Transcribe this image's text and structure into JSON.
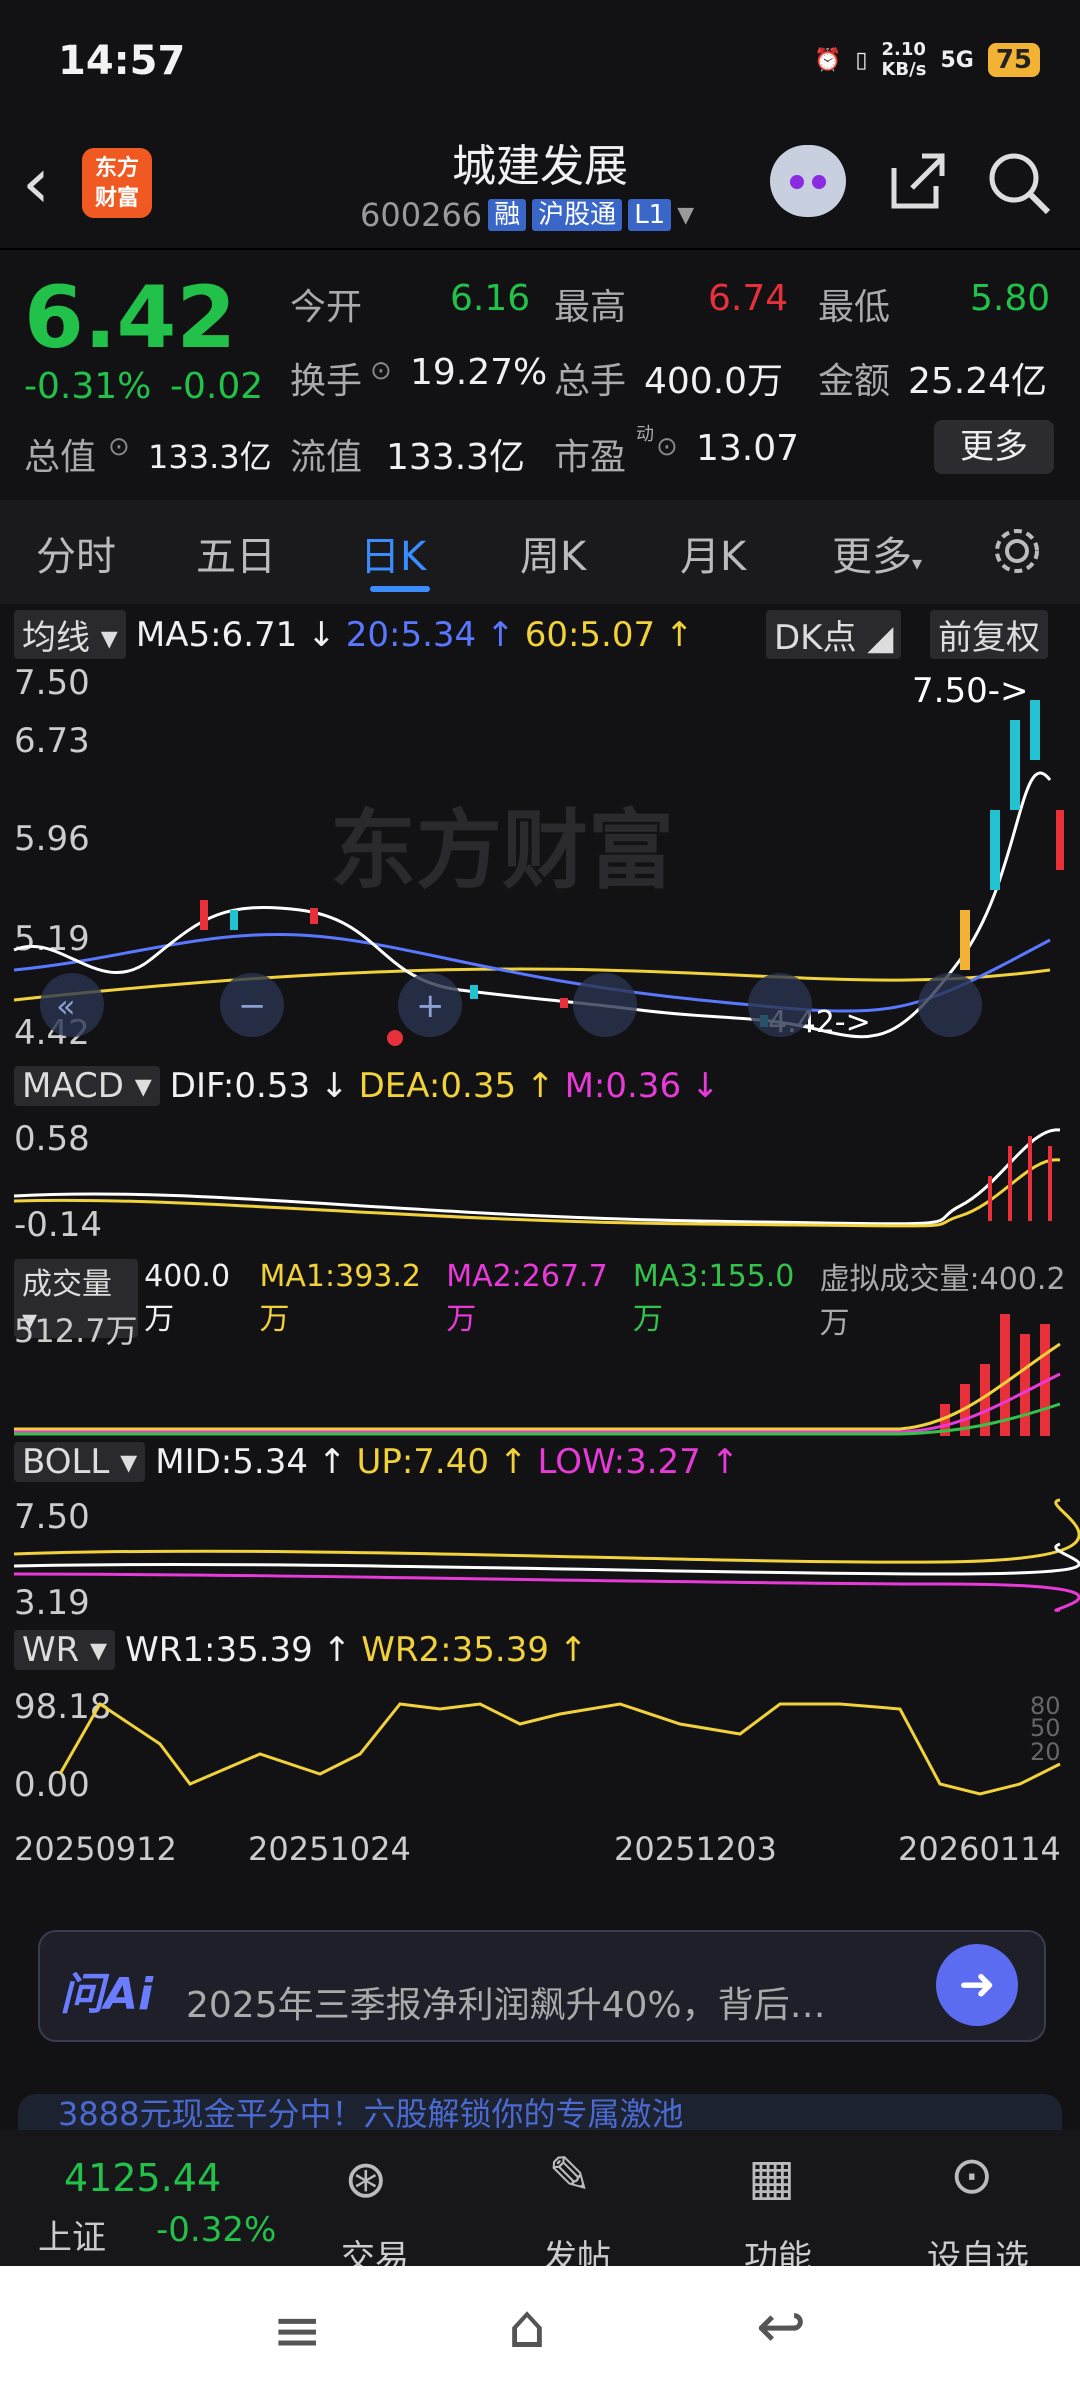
{
  "status": {
    "time": "14:57",
    "net_speed": "2.10",
    "net_unit": "KB/s",
    "signal": "5G",
    "battery": "75"
  },
  "header": {
    "logo_line1": "东方",
    "logo_line2": "财富",
    "stock_name": "城建发展",
    "code": "600266",
    "tag_rong": "融",
    "tag_hgt": "沪股通",
    "tag_level": "L1"
  },
  "quote": {
    "price": "6.42",
    "change_pct": "-0.31%",
    "change": "-0.02",
    "open_label": "今开",
    "open": "6.16",
    "high_label": "最高",
    "high": "6.74",
    "low_label": "最低",
    "low": "5.80",
    "turnover_label": "换手",
    "turnover": "19.27%",
    "volume_label": "总手",
    "volume": "400.0万",
    "amount_label": "金额",
    "amount": "25.24亿",
    "mktcap_label": "总值",
    "mktcap": "133.3亿",
    "float_label": "流值",
    "float_cap": "133.3亿",
    "pe_label": "市盈",
    "pe_sup": "动",
    "pe": "13.07",
    "more": "更多"
  },
  "tabs": [
    "分时",
    "五日",
    "日K",
    "周K",
    "月K",
    "更多"
  ],
  "ma": {
    "selector": "均线",
    "ma5": "MA5:6.71",
    "ma20": "20:5.34",
    "ma60": "60:5.07",
    "dk": "DK点",
    "fq": "前复权"
  },
  "kline_axis": {
    "top": "7.50",
    "l2": "6.73",
    "l3": "5.96",
    "l4": "5.19",
    "bottom": "4.42",
    "hi_mark": "7.50->",
    "lo_mark": "4.42->"
  },
  "macd": {
    "selector": "MACD",
    "dif": "DIF:0.53",
    "dea": "DEA:0.35",
    "m": "M:0.36",
    "top": "0.58",
    "bottom": "-0.14"
  },
  "vol": {
    "selector": "成交量",
    "v": "400.0万",
    "ma1": "MA1:393.2万",
    "ma2": "MA2:267.7万",
    "ma3": "MA3:155.0万",
    "virtual": "虚拟成交量:400.2万",
    "top": "512.7万"
  },
  "boll": {
    "selector": "BOLL",
    "mid": "MID:5.34",
    "up": "UP:7.40",
    "low": "LOW:3.27",
    "top": "7.50",
    "bottom": "3.19"
  },
  "wr": {
    "selector": "WR",
    "wr1": "WR1:35.39",
    "wr2": "WR2:35.39",
    "top": "98.18",
    "bottom": "0.00",
    "r80": "80",
    "r50": "50",
    "r20": "20"
  },
  "dates": [
    "20250912",
    "20251024",
    "20251203",
    "20260114"
  ],
  "ai": {
    "logo": "问Ai",
    "text": "2025年三季报净利润飙升40%，背后…"
  },
  "banner_text": "3888元现金平分中！六股解锁你的专属激池",
  "bottom_nav": {
    "index_value": "4125.44",
    "index_name": "上证",
    "index_change": "-0.32%",
    "items": [
      "交易",
      "发帖",
      "功能",
      "设自选"
    ]
  },
  "colors": {
    "up": "#e8303a",
    "down": "#22c24a",
    "accent": "#3b8cff",
    "ma5": "#ffffff",
    "ma20": "#5a78ff",
    "ma60": "#f2d23a"
  }
}
